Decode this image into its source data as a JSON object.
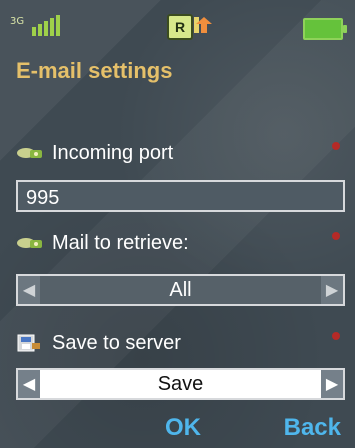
{
  "status": {
    "network_badge": "R"
  },
  "screen": {
    "title": "E-mail settings"
  },
  "fields": {
    "incoming_port": {
      "label": "Incoming port",
      "value": "995"
    },
    "mail_to_retrieve": {
      "label": "Mail to retrieve:",
      "value": "All"
    },
    "save_to_server": {
      "label": "Save to server",
      "value": "Save"
    }
  },
  "softkeys": {
    "ok": "OK",
    "back": "Back"
  },
  "colors": {
    "background": "#3f4a52",
    "title": "#e5c06a",
    "label": "#ffffff",
    "required": "#b52a27",
    "softkey": "#4fb6ec"
  },
  "icons": {
    "signal": "signal-strength-icon",
    "network": "network-badge-icon",
    "transfer": "data-transfer-icon",
    "battery": "battery-icon",
    "incoming": "mail-server-icon",
    "retrieve": "mail-server-icon",
    "save": "save-to-server-icon"
  }
}
